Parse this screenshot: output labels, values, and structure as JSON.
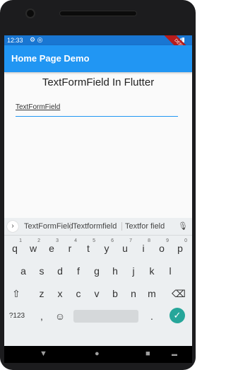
{
  "status": {
    "time": "12:33",
    "left_icons": "⚙ ◎",
    "right_icons": "▼◢▮",
    "ribbon": "DEBUG"
  },
  "appbar": {
    "title": "Home Page Demo"
  },
  "content": {
    "heading": "TextFormField In Flutter",
    "field_value": "TextFormField"
  },
  "keyboard": {
    "suggest_arrow": "›",
    "suggestions": [
      "TextFormField",
      "Textformfield",
      "Textfor field"
    ],
    "mic": "🎙",
    "row1": [
      {
        "k": "q",
        "s": "1"
      },
      {
        "k": "w",
        "s": "2"
      },
      {
        "k": "e",
        "s": "3"
      },
      {
        "k": "r",
        "s": "4"
      },
      {
        "k": "t",
        "s": "5"
      },
      {
        "k": "y",
        "s": "6"
      },
      {
        "k": "u",
        "s": "7"
      },
      {
        "k": "i",
        "s": "8"
      },
      {
        "k": "o",
        "s": "9"
      },
      {
        "k": "p",
        "s": "0"
      }
    ],
    "row2": [
      "a",
      "s",
      "d",
      "f",
      "g",
      "h",
      "j",
      "k",
      "l"
    ],
    "row3": [
      "z",
      "x",
      "c",
      "v",
      "b",
      "n",
      "m"
    ],
    "shift": "⇧",
    "backspace": "⌫",
    "symbols": "?123",
    "comma": ",",
    "emoji": "☺",
    "period": ".",
    "enter": "✓"
  },
  "nav": {
    "back": "▼",
    "home": "●",
    "recent": "■",
    "extra": "▬"
  },
  "colors": {
    "appbar": "#2196f3",
    "statusbar": "#1976d2",
    "underline": "#2196f3",
    "enter": "#26a69a"
  }
}
